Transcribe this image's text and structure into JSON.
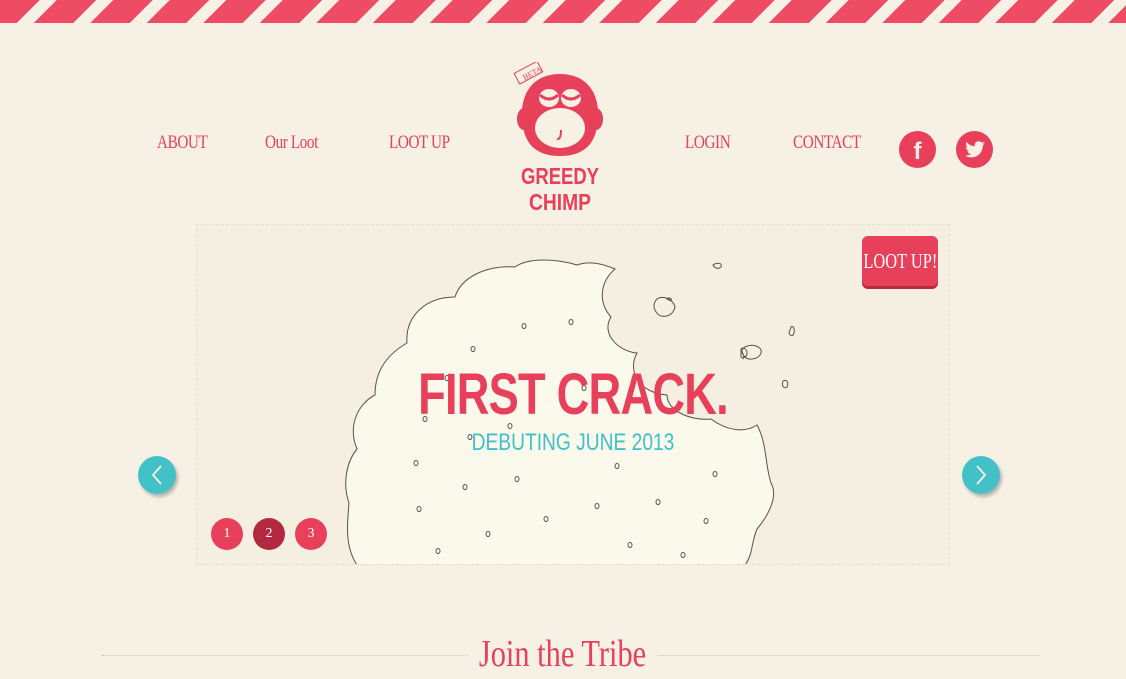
{
  "nav": {
    "left": [
      "ABOUT",
      "Our Loot",
      "LOOT UP"
    ],
    "right": [
      "LOGIN",
      "CONTACT"
    ]
  },
  "logo": {
    "badge": "BETA",
    "line1": "GREEDY",
    "line2": "CHIMP"
  },
  "social": {
    "facebook_icon": "f"
  },
  "slider": {
    "headline": "FIRST CRACK.",
    "subline": "DEBUTING JUNE 2013",
    "cta": "LOOT UP!",
    "pages": [
      "1",
      "2",
      "3"
    ],
    "active_page": "2"
  },
  "section": {
    "title": "Join the Tribe"
  },
  "colors": {
    "brand": "#e8405a",
    "accent": "#43c1c8",
    "background": "#f6f1e4"
  }
}
